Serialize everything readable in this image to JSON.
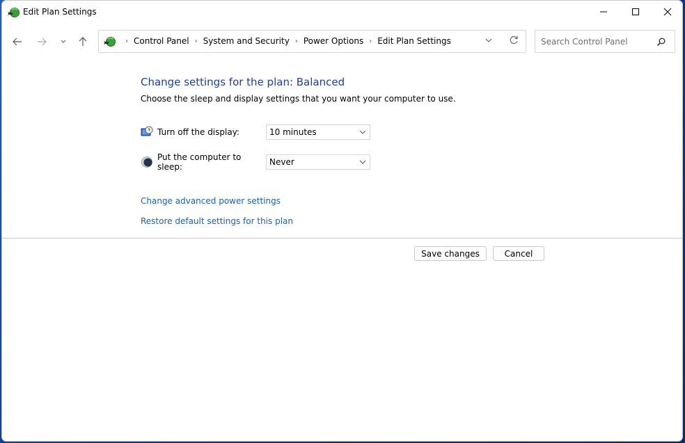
{
  "window": {
    "title": "Edit Plan Settings",
    "icon": "power-options-icon"
  },
  "titlebar_controls": [
    "minimize-icon",
    "maximize-icon",
    "close-icon"
  ],
  "navigation": {
    "back": "arrow-left-icon",
    "forward": "arrow-right-icon",
    "recent": "chevron-down-icon",
    "up": "arrow-up-icon"
  },
  "address_bar": {
    "breadcrumbs": [
      "Control Panel",
      "System and Security",
      "Power Options",
      "Edit Plan Settings"
    ],
    "separator": "›"
  },
  "search": {
    "placeholder": "Search Control Panel",
    "value": ""
  },
  "main": {
    "heading": "Change settings for the plan: Balanced",
    "description": "Choose the sleep and display settings that you want your computer to use.",
    "settings": [
      {
        "label": "Turn off the display:",
        "value": "10 minutes",
        "icon": "monitor-clock-icon"
      },
      {
        "label": "Put the computer to sleep:",
        "value": "Never",
        "icon": "moon-icon"
      }
    ],
    "links": {
      "advanced": "Change advanced power settings",
      "restore": "Restore default settings for this plan"
    },
    "buttons": {
      "save": "Save changes",
      "cancel": "Cancel"
    }
  },
  "colors": {
    "heading": "#1e3e9a",
    "link": "#1a5fb4",
    "desktop": "#0b3a8c"
  }
}
